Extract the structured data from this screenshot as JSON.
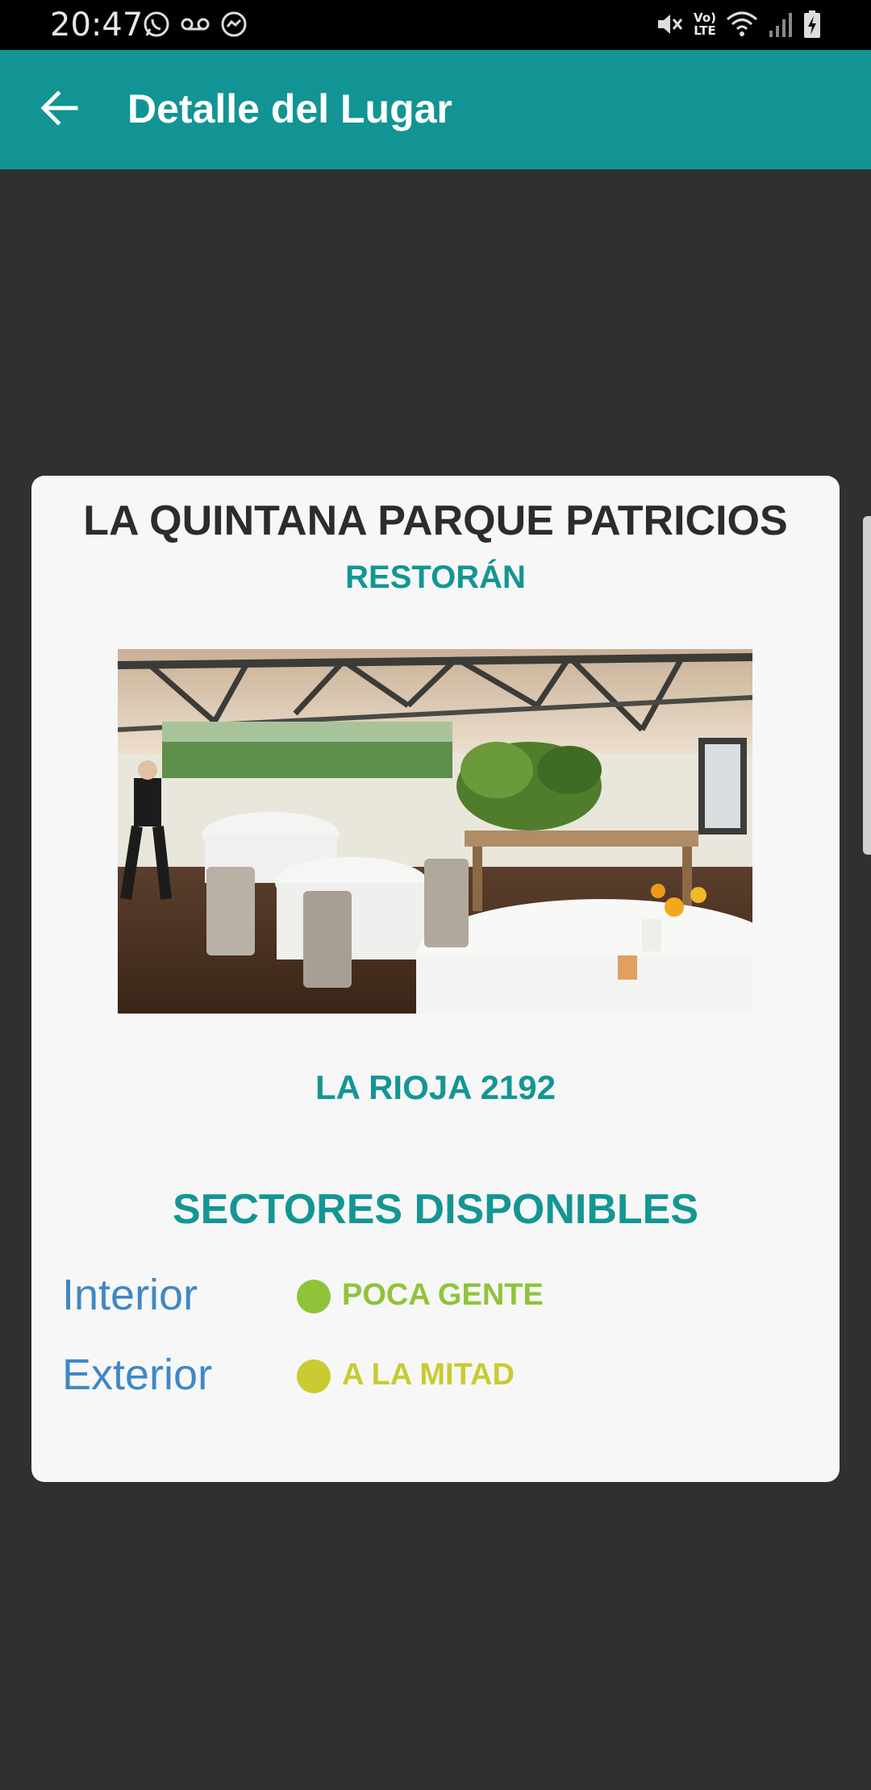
{
  "status_bar": {
    "time": "20:47",
    "left_icons": [
      "whatsapp-icon",
      "voicemail-icon",
      "messenger-icon"
    ],
    "right_icons": [
      "mute-icon",
      "volte-icon",
      "wifi-icon",
      "signal-icon",
      "battery-charging-icon"
    ],
    "volte_label": "Vo)\nLTE"
  },
  "app_bar": {
    "title": "Detalle del Lugar",
    "back_icon": "arrow-left-icon",
    "color": "#129494"
  },
  "place": {
    "name": "LA QUINTANA PARQUE PATRICIOS",
    "type": "RESTORÁN",
    "address": "LA RIOJA 2192",
    "photo": "restaurant-dining-room-photo"
  },
  "sectors": {
    "title": "SECTORES DISPONIBLES",
    "items": [
      {
        "name": "Interior",
        "status": "POCA GENTE",
        "color": "#8fc43a"
      },
      {
        "name": "Exterior",
        "status": "A LA MITAD",
        "color": "#c9cb32"
      }
    ]
  },
  "colors": {
    "accent": "#139693",
    "background": "#303030",
    "card": "#f7f7f7",
    "sector_name": "#3f88c5"
  }
}
